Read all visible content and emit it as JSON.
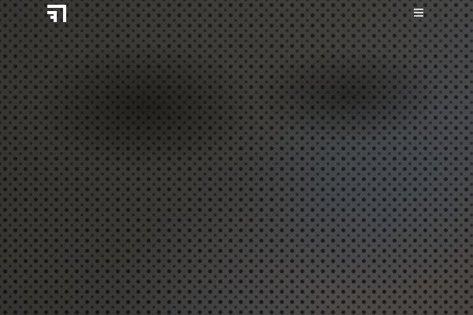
{
  "header": {
    "logo_icon": "brand-logo-mark",
    "menu_icon": "hamburger-menu-icon"
  },
  "colors": {
    "nav_foreground": "#ffffff",
    "background": "#3a3834"
  }
}
